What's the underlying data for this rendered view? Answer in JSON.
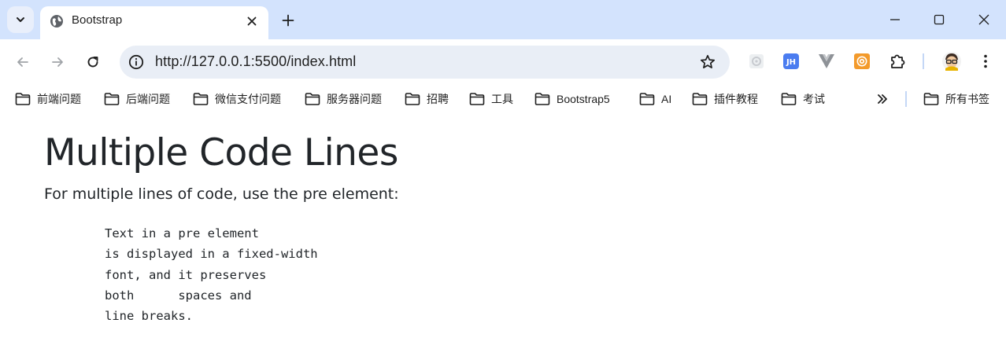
{
  "browser": {
    "tab": {
      "title": "Bootstrap"
    },
    "address_bar": {
      "url": "http://127.0.0.1:5500/index.html"
    },
    "extensions": [
      "ext-grey-icon",
      "jh-icon",
      "vue-devtools-icon",
      "orange-extension-icon",
      "puzzle-icon",
      "profile-avatar"
    ],
    "extension_badge": "JH"
  },
  "bookmarks": {
    "items": [
      {
        "label": "前端问题"
      },
      {
        "label": "后端问题"
      },
      {
        "label": "微信支付问题"
      },
      {
        "label": "服务器问题"
      },
      {
        "label": "招聘"
      },
      {
        "label": "工具"
      },
      {
        "label": "Bootstrap5"
      },
      {
        "label": "AI"
      },
      {
        "label": "插件教程"
      },
      {
        "label": "考试"
      }
    ],
    "all_bookmarks_label": "所有书签"
  },
  "page": {
    "heading": "Multiple Code Lines",
    "lead": "For multiple lines of code, use the pre element:",
    "pre_text": "Text in a pre element\nis displayed in a fixed-width\nfont, and it preserves\nboth      spaces and\nline breaks."
  },
  "colors": {
    "tabstrip": "#d3e3fd",
    "omnibox": "#e9eef6",
    "text": "#212529"
  }
}
